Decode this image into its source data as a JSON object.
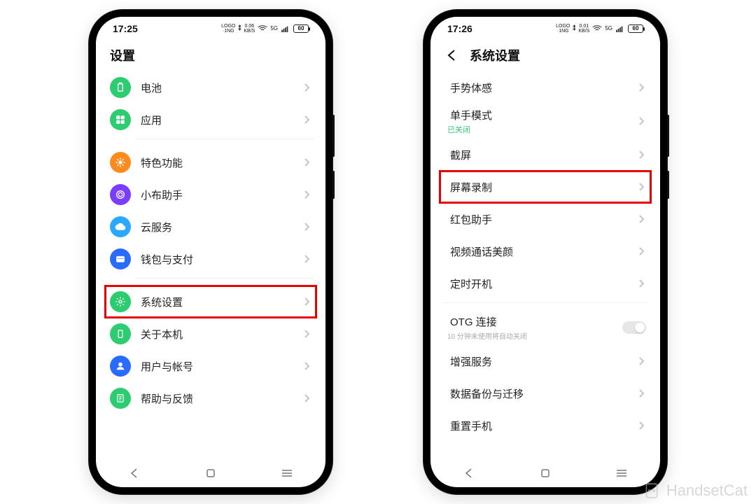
{
  "watermark": "HandsetCat",
  "phone1": {
    "status": {
      "time": "17:25",
      "net": "LOGO",
      "speed_top": "0.06",
      "speed_bot": "KB/S",
      "sig": "5G",
      "battery": "60"
    },
    "title": "设置",
    "groups": [
      {
        "items": [
          {
            "id": "battery",
            "label": "电池",
            "icon": "battery",
            "color": "#2ecc71"
          },
          {
            "id": "apps",
            "label": "应用",
            "icon": "grid",
            "color": "#2ecc71"
          }
        ]
      },
      {
        "items": [
          {
            "id": "features",
            "label": "特色功能",
            "icon": "star",
            "color": "#ff8a1e"
          },
          {
            "id": "assistant",
            "label": "小布助手",
            "icon": "spiral",
            "color": "#7a3cff"
          },
          {
            "id": "cloud",
            "label": "云服务",
            "icon": "cloud",
            "color": "#2aa7ff"
          },
          {
            "id": "wallet",
            "label": "钱包与支付",
            "icon": "wallet",
            "color": "#2a6bff"
          }
        ]
      },
      {
        "items": [
          {
            "id": "system",
            "label": "系统设置",
            "icon": "gear",
            "color": "#2ecc71",
            "highlight": true
          },
          {
            "id": "about",
            "label": "关于本机",
            "icon": "phone",
            "color": "#2ecc71"
          },
          {
            "id": "users",
            "label": "用户与帐号",
            "icon": "user",
            "color": "#2a6bff"
          },
          {
            "id": "help",
            "label": "帮助与反馈",
            "icon": "help",
            "color": "#2ecc71"
          }
        ]
      }
    ]
  },
  "phone2": {
    "status": {
      "time": "17:26",
      "net": "LOGO",
      "speed_top": "0.01",
      "speed_bot": "KB/S",
      "sig": "5G",
      "battery": "60"
    },
    "title": "系统设置",
    "groups": [
      {
        "items": [
          {
            "id": "gesture",
            "label": "手势体感"
          },
          {
            "id": "onehand",
            "label": "单手模式",
            "sub": "已关闭",
            "sub_color": "green"
          },
          {
            "id": "screenshot",
            "label": "截屏"
          },
          {
            "id": "record",
            "label": "屏幕录制",
            "highlight": true
          },
          {
            "id": "redpacket",
            "label": "红包助手"
          },
          {
            "id": "videocall",
            "label": "视频通话美颜"
          },
          {
            "id": "schedule",
            "label": "定时开机"
          }
        ]
      },
      {
        "items": [
          {
            "id": "otg",
            "label": "OTG 连接",
            "sub": "10 分钟未使用将自动关闭",
            "sub_color": "grey",
            "toggle": true
          },
          {
            "id": "enhance",
            "label": "增强服务"
          },
          {
            "id": "backup",
            "label": "数据备份与迁移"
          },
          {
            "id": "reset",
            "label": "重置手机"
          }
        ]
      }
    ]
  }
}
